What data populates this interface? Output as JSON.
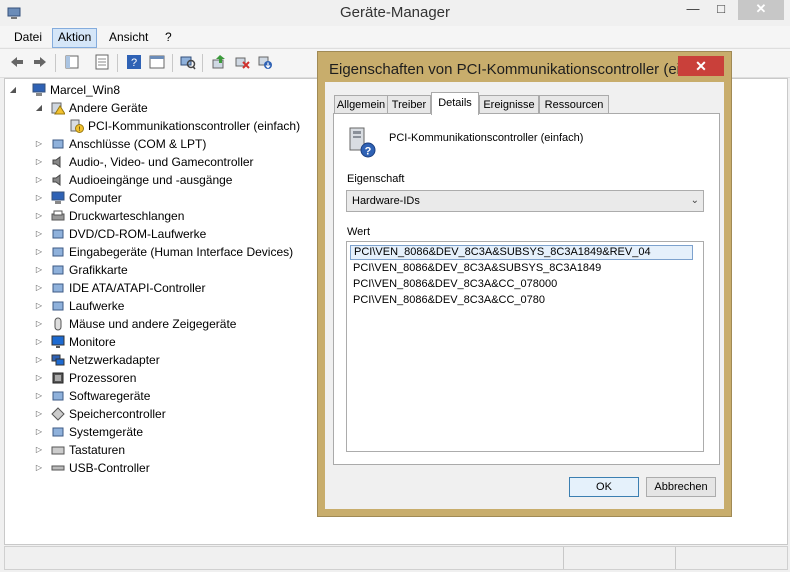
{
  "window": {
    "title": "Geräte-Manager"
  },
  "menubar": {
    "items": [
      "Datei",
      "Aktion",
      "Ansicht",
      "?"
    ],
    "active_index": 1
  },
  "toolbar": {
    "icons": [
      "back-icon",
      "forward-icon",
      "show-hide-tree-icon",
      "properties-icon",
      "help-icon",
      "view-icon",
      "scan-hardware-icon",
      "update-driver-icon",
      "uninstall-icon",
      "disable-icon"
    ]
  },
  "tree": {
    "root": "Marcel_Win8",
    "categories": [
      {
        "label": "Andere Geräte",
        "icon": "warning-device-icon",
        "expanded": true
      },
      {
        "label": "PCI-Kommunikationscontroller (einfach)",
        "icon": "unknown-device-icon",
        "child": true
      },
      {
        "label": "Anschlüsse (COM & LPT)",
        "icon": "port-icon"
      },
      {
        "label": "Audio-, Video- und Gamecontroller",
        "icon": "speaker-icon"
      },
      {
        "label": "Audioeingänge und -ausgänge",
        "icon": "speaker-icon"
      },
      {
        "label": "Computer",
        "icon": "computer-icon"
      },
      {
        "label": "Druckwarteschlangen",
        "icon": "printer-icon"
      },
      {
        "label": "DVD/CD-ROM-Laufwerke",
        "icon": "dvd-drive-icon"
      },
      {
        "label": "Eingabegeräte (Human Interface Devices)",
        "icon": "hid-icon"
      },
      {
        "label": "Grafikkarte",
        "icon": "display-adapter-icon"
      },
      {
        "label": "IDE ATA/ATAPI-Controller",
        "icon": "ide-controller-icon"
      },
      {
        "label": "Laufwerke",
        "icon": "disk-drive-icon"
      },
      {
        "label": "Mäuse und andere Zeigegeräte",
        "icon": "mouse-icon"
      },
      {
        "label": "Monitore",
        "icon": "monitor-icon"
      },
      {
        "label": "Netzwerkadapter",
        "icon": "network-adapter-icon"
      },
      {
        "label": "Prozessoren",
        "icon": "processor-icon"
      },
      {
        "label": "Softwaregeräte",
        "icon": "software-device-icon"
      },
      {
        "label": "Speichercontroller",
        "icon": "storage-controller-icon"
      },
      {
        "label": "Systemgeräte",
        "icon": "system-device-icon"
      },
      {
        "label": "Tastaturen",
        "icon": "keyboard-icon"
      },
      {
        "label": "USB-Controller",
        "icon": "usb-icon"
      }
    ]
  },
  "dialog": {
    "title": "Eigenschaften von PCI-Kommunikationscontroller (ein...",
    "tabs": [
      "Allgemein",
      "Treiber",
      "Details",
      "Ereignisse",
      "Ressourcen"
    ],
    "active_tab": 2,
    "device_name": "PCI-Kommunikationscontroller (einfach)",
    "property_label": "Eigenschaft",
    "property_value": "Hardware-IDs",
    "value_label": "Wert",
    "values": [
      "PCI\\VEN_8086&DEV_8C3A&SUBSYS_8C3A1849&REV_04",
      "PCI\\VEN_8086&DEV_8C3A&SUBSYS_8C3A1849",
      "PCI\\VEN_8086&DEV_8C3A&CC_078000",
      "PCI\\VEN_8086&DEV_8C3A&CC_0780"
    ],
    "selected_value_index": 0,
    "ok_label": "OK",
    "cancel_label": "Abbrechen"
  },
  "colors": {
    "dialog_frame": "#c8ad6c",
    "close_red": "#c9403a",
    "selection": "#e5f0fb"
  }
}
